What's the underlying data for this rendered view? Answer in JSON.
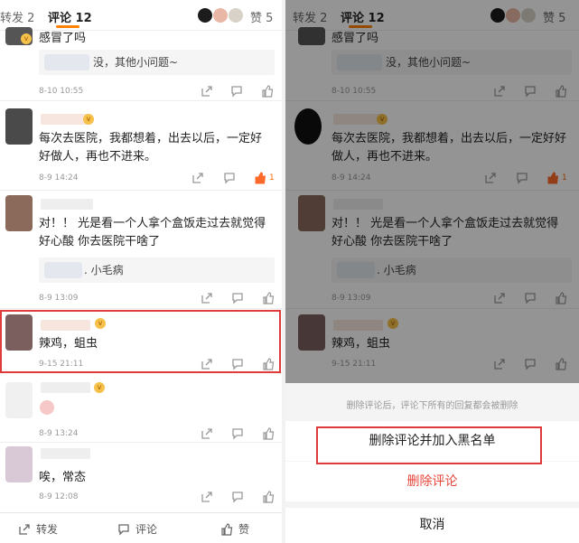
{
  "tabs": {
    "reposts": "转发 2",
    "comments_label": "评论",
    "comments_count": "12",
    "likes": "赞 5"
  },
  "comments": [
    {
      "text": "感冒了吗",
      "reply": "没，其他小问题~",
      "time": "8-10 10:55",
      "like_count": ""
    },
    {
      "text": "每次去医院，我都想着，出去以后，一定好好做人，再也不进来。",
      "reply": "",
      "time": "8-9 14:24",
      "like_count": "1"
    },
    {
      "text": "对！！ 光是看一个人拿个盒饭走过去就觉得好心酸 你去医院干啥了",
      "reply": ". 小毛病",
      "time": "8-9 13:09",
      "like_count": ""
    },
    {
      "text": "辣鸡，蛆虫",
      "reply": "",
      "time": "9-15 21:11",
      "like_count": ""
    },
    {
      "text": "",
      "reply": "",
      "time": "8-9 13:24",
      "like_count": ""
    },
    {
      "text": "唉，常态",
      "reply": "",
      "time": "8-9 12:08",
      "like_count": ""
    }
  ],
  "bottom_bar": {
    "repost": "转发",
    "comment": "评论",
    "like": "赞"
  },
  "action_sheet": {
    "hint": "删除评论后，评论下所有的回复都会被删除",
    "delete_and_block": "删除评论并加入黑名单",
    "delete": "删除评论",
    "cancel": "取消"
  },
  "colors": {
    "accent": "#ff8200",
    "highlight": "#e03b3b",
    "danger": "#e8453b"
  }
}
